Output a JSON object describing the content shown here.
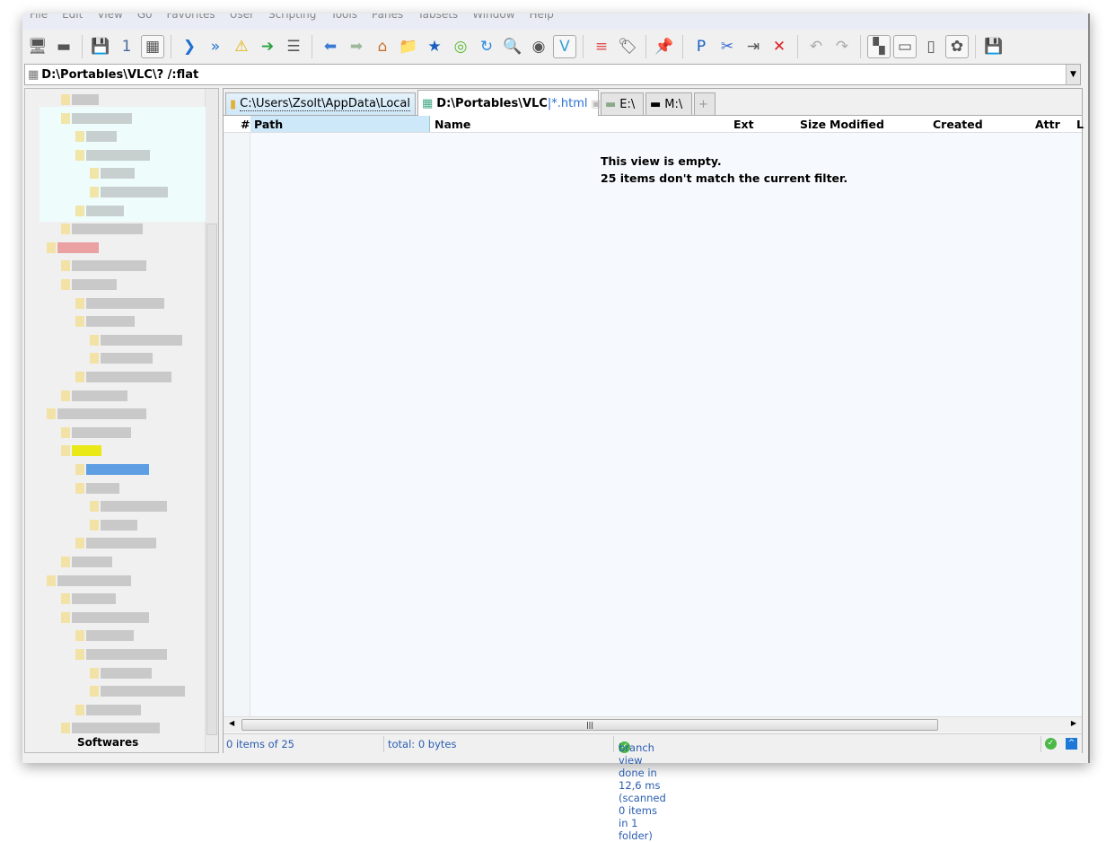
{
  "menu": [
    "File",
    "Edit",
    "View",
    "Go",
    "Favorites",
    "User",
    "Scripting",
    "Tools",
    "Panes",
    "Tabsets",
    "Window",
    "Help"
  ],
  "toolbar": [
    {
      "icon": "computer-icon",
      "g": "🖥"
    },
    {
      "icon": "drive-m-icon",
      "g": "▬"
    },
    {
      "sep": true
    },
    {
      "icon": "save-icon",
      "g": "💾"
    },
    {
      "icon": "pane-one-icon",
      "g": "1"
    },
    {
      "icon": "dual-pane-icon",
      "g": "▦",
      "on": true
    },
    {
      "sep": true
    },
    {
      "icon": "go-icon",
      "g": "❯"
    },
    {
      "icon": "go-fast-icon",
      "g": "»"
    },
    {
      "icon": "pedestrian-sign-icon",
      "g": "⚠"
    },
    {
      "icon": "green-arrow-box-icon",
      "g": "➔"
    },
    {
      "icon": "list-icon",
      "g": "☰"
    },
    {
      "sep": true
    },
    {
      "icon": "back-arrow-icon",
      "g": "⬅"
    },
    {
      "icon": "forward-arrow-icon",
      "g": "➡"
    },
    {
      "icon": "home-icon",
      "g": "⌂"
    },
    {
      "icon": "folder-icon",
      "g": "📁"
    },
    {
      "icon": "star-icon",
      "g": "★"
    },
    {
      "icon": "target-icon",
      "g": "◎"
    },
    {
      "icon": "refresh-icon",
      "g": "↻"
    },
    {
      "icon": "search-icon",
      "g": "🔍"
    },
    {
      "icon": "circle-arrow-icon",
      "g": "◉"
    },
    {
      "icon": "filter-icon",
      "g": "V",
      "on": true
    },
    {
      "sep": true
    },
    {
      "icon": "stack-icon",
      "g": "≡"
    },
    {
      "icon": "tag-icon",
      "g": "🏷"
    },
    {
      "sep": true
    },
    {
      "icon": "pin-icon",
      "g": "📌"
    },
    {
      "sep": true
    },
    {
      "icon": "paste-icon",
      "g": "P"
    },
    {
      "icon": "scissors-icon",
      "g": "✂"
    },
    {
      "icon": "move-to-icon",
      "g": "⇥"
    },
    {
      "icon": "delete-icon",
      "g": "✕"
    },
    {
      "sep": true
    },
    {
      "icon": "undo-icon",
      "g": "↶"
    },
    {
      "icon": "redo-icon",
      "g": "↷"
    },
    {
      "sep": true
    },
    {
      "icon": "layout-icon",
      "g": "▚",
      "on": true
    },
    {
      "icon": "window-icon",
      "g": "▭",
      "on": true
    },
    {
      "icon": "vertical-split-icon",
      "g": "▯"
    },
    {
      "icon": "pinwheel-icon",
      "g": "✿",
      "on": true
    },
    {
      "sep": true
    },
    {
      "icon": "floppy-icon",
      "g": "💾"
    }
  ],
  "address": {
    "value": "D:\\Portables\\VLC\\? /:flat"
  },
  "tree": {
    "visible_label": "Softwares"
  },
  "tabs": [
    {
      "label": "C:\\Users\\Zsolt\\AppData\\Local",
      "icon": "folder-icon"
    },
    {
      "label": "D:\\Portables\\VLC",
      "filter": "|*.html",
      "icon": "flat-view-icon",
      "active": true
    },
    {
      "label": "E:\\",
      "icon": "drive-icon"
    },
    {
      "label": "M:\\",
      "icon": "drive-icon"
    },
    {
      "label": "+",
      "icon": "new-tab-icon"
    }
  ],
  "columns": [
    "#",
    "Path",
    "Name",
    "Ext",
    "Size",
    "Modified",
    "Created",
    "Attr",
    "L"
  ],
  "empty": {
    "line1": "This view is empty.",
    "line2": "25 items don't match the current filter."
  },
  "status": {
    "items": "0 items of 25",
    "total": "total: 0 bytes",
    "branch": "branch view done in 12,6 ms (scanned 0 items in 1 folder)"
  },
  "colors": {
    "accent": "#2a5db0",
    "selected_header": "#cde8f8"
  }
}
